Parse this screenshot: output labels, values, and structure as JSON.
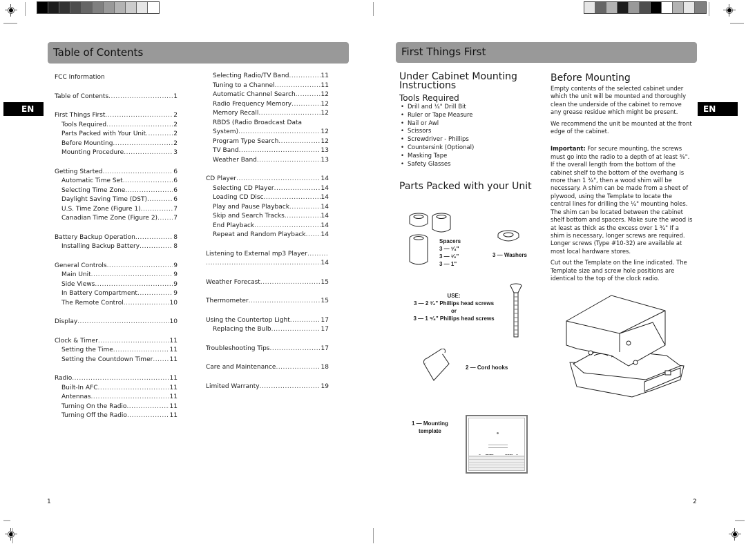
{
  "left_page": {
    "banner_title": "Table of Contents",
    "language_tab": "EN",
    "page_number": "1",
    "toc_col1": [
      {
        "label": "FCC Information",
        "page": "",
        "level": 0,
        "gap_after": true
      },
      {
        "label": "Table of Contents",
        "page": "1",
        "level": 0,
        "gap_after": true
      },
      {
        "label": "First Things First",
        "page": "2",
        "level": 0
      },
      {
        "label": "Tools Required",
        "page": "2",
        "level": 1
      },
      {
        "label": "Parts Packed with Your Unit",
        "page": "2",
        "level": 1
      },
      {
        "label": "Before Mounting",
        "page": "2",
        "level": 1
      },
      {
        "label": "Mounting Procedure",
        "page": "3",
        "level": 1,
        "gap_after": true
      },
      {
        "label": "Getting Started",
        "page": "6",
        "level": 0
      },
      {
        "label": "Automatic Time Set",
        "page": "6",
        "level": 1
      },
      {
        "label": "Selecting Time Zone",
        "page": "6",
        "level": 1
      },
      {
        "label": "Daylight Saving Time (DST)",
        "page": "6",
        "level": 1
      },
      {
        "label": "U.S. Time Zone (Figure 1)",
        "page": "7",
        "level": 1
      },
      {
        "label": "Canadian Time Zone (Figure 2)",
        "page": "7",
        "level": 1,
        "gap_after": true
      },
      {
        "label": "Battery Backup Operation",
        "page": "8",
        "level": 0
      },
      {
        "label": "Installing Backup Battery",
        "page": "8",
        "level": 1,
        "gap_after": true
      },
      {
        "label": "General Controls",
        "page": "9",
        "level": 0
      },
      {
        "label": "Main Unit",
        "page": "9",
        "level": 1
      },
      {
        "label": "Side Views",
        "page": "9",
        "level": 1
      },
      {
        "label": "In Battery Compartment",
        "page": "9",
        "level": 1
      },
      {
        "label": "The Remote Control",
        "page": "10",
        "level": 1,
        "gap_after": true
      },
      {
        "label": "Display",
        "page": "10",
        "level": 0,
        "gap_after": true
      },
      {
        "label": "Clock & Timer",
        "page": "11",
        "level": 0
      },
      {
        "label": "Setting the Time",
        "page": "11",
        "level": 1
      },
      {
        "label": "Setting the Countdown Timer",
        "page": "11",
        "level": 1,
        "gap_after": true
      },
      {
        "label": "Radio",
        "page": "11",
        "level": 0
      },
      {
        "label": "Built-In AFC",
        "page": "11",
        "level": 1
      },
      {
        "label": "Antennas",
        "page": "11",
        "level": 1
      },
      {
        "label": "Turning On the Radio",
        "page": "11",
        "level": 1
      },
      {
        "label": "Turning Off the Radio",
        "page": "11",
        "level": 1
      }
    ],
    "toc_col2": [
      {
        "label": "Selecting Radio/TV Band",
        "page": "11",
        "level": 1
      },
      {
        "label": "Tuning to a Channel",
        "page": "11",
        "level": 1
      },
      {
        "label": "Automatic Channel Search",
        "page": "12",
        "level": 1
      },
      {
        "label": "Radio Frequency Memory",
        "page": "12",
        "level": 1
      },
      {
        "label": "Memory Recall",
        "page": "12",
        "level": 1
      },
      {
        "label": "RBDS (Radio Broadcast Data",
        "page": "",
        "level": 1,
        "nodots": true
      },
      {
        "label": "System)",
        "page": "12",
        "level": 1
      },
      {
        "label": "Program Type Search",
        "page": "12",
        "level": 1
      },
      {
        "label": "TV Band",
        "page": "13",
        "level": 1
      },
      {
        "label": "Weather Band",
        "page": "13",
        "level": 1,
        "gap_after": true
      },
      {
        "label": "CD Player",
        "page": "14",
        "level": 0
      },
      {
        "label": "Selecting CD Player",
        "page": "14",
        "level": 1
      },
      {
        "label": "Loading CD Disc",
        "page": "14",
        "level": 1
      },
      {
        "label": "Play and Pause Playback",
        "page": "14",
        "level": 1
      },
      {
        "label": "Skip and Search Tracks",
        "page": "14",
        "level": 1
      },
      {
        "label": "End Playback",
        "page": "14",
        "level": 1
      },
      {
        "label": "Repeat and Random Playback",
        "page": "14",
        "level": 1,
        "gap_after": true
      },
      {
        "label": "Listening to External mp3 Player",
        "page": "",
        "level": 0
      },
      {
        "label": "",
        "page": "14",
        "level": 0,
        "gap_after": true
      },
      {
        "label": "Weather Forecast",
        "page": "15",
        "level": 0,
        "gap_after": true
      },
      {
        "label": "Thermometer",
        "page": "15",
        "level": 0,
        "gap_after": true
      },
      {
        "label": "Using the Countertop Light",
        "page": "17",
        "level": 0
      },
      {
        "label": "Replacing the Bulb",
        "page": "17",
        "level": 1,
        "gap_after": true
      },
      {
        "label": "Troubleshooting Tips",
        "page": "17",
        "level": 0,
        "gap_after": true
      },
      {
        "label": "Care and Maintenance",
        "page": "18",
        "level": 0,
        "gap_after": true
      },
      {
        "label": "Limited Warranty",
        "page": "19",
        "level": 0
      }
    ]
  },
  "right_page": {
    "banner_title": "First Things First",
    "language_tab": "EN",
    "page_number": "2",
    "under_cabinet": {
      "heading_line1": "Under Cabinet Mounting",
      "heading_line2": "Instructions",
      "tools_heading": "Tools Required",
      "tools": [
        "Drill and ¹⁄₄\" Drill Bit",
        "Ruler or Tape Measure",
        "Nail or Awl",
        "Scissors",
        "Screwdriver - Phillips",
        "Countersink (Optional)",
        "Masking Tape",
        "Safety Glasses"
      ]
    },
    "parts": {
      "heading": "Parts Packed with your Unit",
      "spacers_label": "Spacers",
      "spacers": [
        "3 — ¹⁄₄\"",
        "3 — ¹⁄₂\"",
        "3 — 1\""
      ],
      "washers_label": "3 — Washers",
      "use_label": "USE:",
      "screws_option1": "3 — 2 ³⁄₄\" Phillips head screws",
      "or_label": "or",
      "screws_option2": "3 — 1 ⁵⁄₈\" Phillips head screws",
      "cord_hooks_label": "2 — Cord hooks",
      "template_label_line1": "1 — Mounting",
      "template_label_line2": "template",
      "template_front": "FRONT",
      "template_avant": "AVANT"
    },
    "before_mounting": {
      "heading": "Before Mounting",
      "p1": "Empty contents of the selected cabinet under which the unit will be mounted and thoroughly clean the underside of the cabinet to remove any grease residue which might be present.",
      "p2": "We recommend the unit be mounted at the front edge of the cabinet.",
      "p3_bold": "Important:",
      "p3": " For secure mounting, the screws must go into the radio to a depth of at least ³⁄₈\". If the overall length from the bottom of the cabinet shelf to the bottom of the overhang is more than 1 ³⁄₄\", then a wood shim will be necessary. A shim can be made from a sheet of plywood, using the Template to locate the central lines for drilling the ¹⁄₄\" mounting holes. The shim can be located between the cabinet shelf bottom and spacers. Make sure the wood is at least as thick as the excess over 1 ³⁄₄\" If a shim is necessary, longer screws are required. Longer screws (Type #10-32) are  available at most local hardware stores.",
      "p4": "Cut out the Template on the line indicated. The Template size and screw hole positions are identical to the top of the clock radio."
    }
  },
  "print_marks": {
    "left_swatches": [
      "#000000",
      "#1c1c1c",
      "#333333",
      "#4d4d4d",
      "#666666",
      "#808080",
      "#999999",
      "#b3b3b3",
      "#cccccc",
      "#e6e6e6",
      "#ffffff"
    ],
    "right_swatches": [
      "#e6e6e6",
      "#666666",
      "#b3b3b3",
      "#1c1c1c",
      "#999999",
      "#4d4d4d",
      "#000000",
      "#ffffff",
      "#b3b3b3",
      "#e6e6e6",
      "#808080"
    ]
  }
}
